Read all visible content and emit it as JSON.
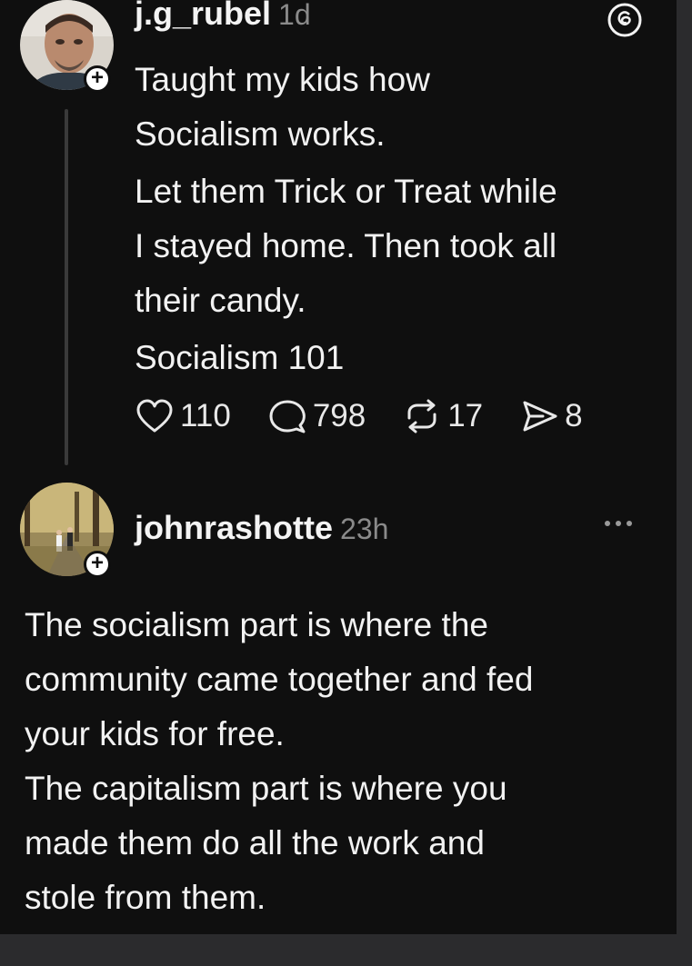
{
  "post": {
    "username": "j.g_rubel",
    "time": "1d",
    "paragraphs": [
      [
        "Taught my kids how",
        "Socialism works."
      ],
      [
        "Let them Trick or Treat while",
        "I stayed home. Then took all",
        "their candy."
      ],
      [
        "Socialism 101"
      ]
    ],
    "stats": {
      "likes": "110",
      "replies": "798",
      "reposts": "17",
      "shares": "8"
    }
  },
  "reply": {
    "username": "johnrashotte",
    "time": "23h",
    "paragraphs": [
      [
        "The socialism part is where the",
        "community came together and fed",
        "your kids for free."
      ],
      [
        "The capitalism part is where you",
        "made them do all the work and",
        "stole from them."
      ]
    ]
  },
  "icons": {
    "follow": "plus-icon",
    "app_logo": "threads-logo-icon",
    "like": "heart-icon",
    "reply": "comment-icon",
    "repost": "repost-icon",
    "share": "send-icon",
    "more": "more-horizontal-icon"
  },
  "colors": {
    "background": "#0f0f0f",
    "text": "#f2f2f2",
    "muted": "#8a8a8a",
    "thread_line": "#3a3a3a"
  }
}
